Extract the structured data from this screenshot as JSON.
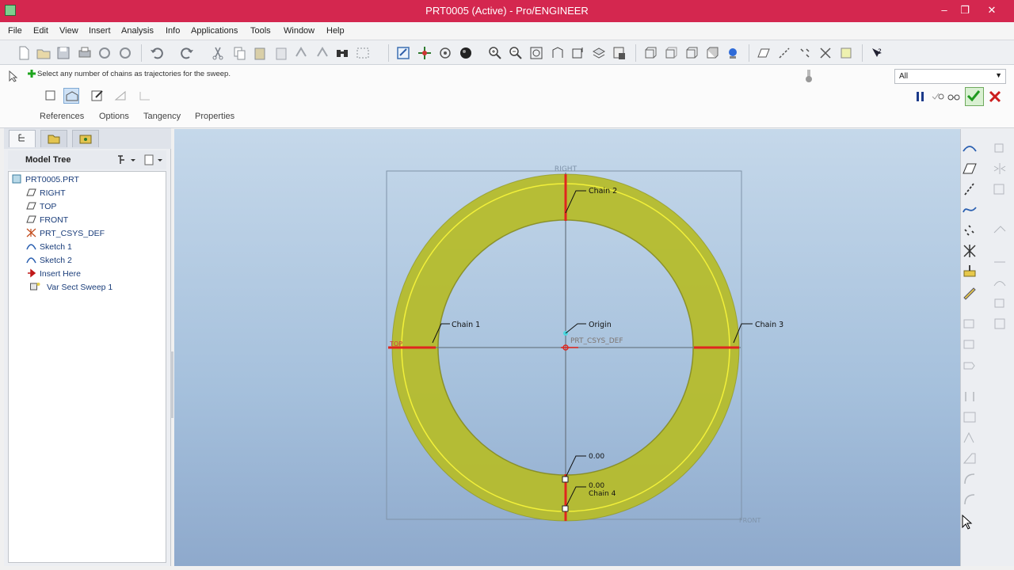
{
  "window": {
    "title": "PRT0005 (Active) - Pro/ENGINEER",
    "minimize": "–",
    "restore": "❐",
    "close": "✕"
  },
  "menu": [
    "File",
    "Edit",
    "View",
    "Insert",
    "Analysis",
    "Info",
    "Applications",
    "Tools",
    "Window",
    "Help"
  ],
  "dashboard": {
    "prompt": "Select any number of chains as trajectories for the sweep.",
    "filter_value": "All",
    "tabs": [
      "References",
      "Options",
      "Tangency",
      "Properties"
    ]
  },
  "navigator": {
    "title": "Model Tree",
    "items": [
      {
        "label": "PRT0005.PRT",
        "icon": "part-icon"
      },
      {
        "label": "RIGHT",
        "icon": "datum-plane-icon"
      },
      {
        "label": "TOP",
        "icon": "datum-plane-icon"
      },
      {
        "label": "FRONT",
        "icon": "datum-plane-icon"
      },
      {
        "label": "PRT_CSYS_DEF",
        "icon": "csys-icon"
      },
      {
        "label": "Sketch 1",
        "icon": "sketch-icon"
      },
      {
        "label": "Sketch 2",
        "icon": "sketch-icon"
      },
      {
        "label": "Insert Here",
        "icon": "insert-arrow-icon"
      },
      {
        "label": "Var Sect Sweep 1",
        "icon": "sweep-feature-icon"
      }
    ]
  },
  "graphics": {
    "plane_right": "RIGHT",
    "plane_top": "TOP",
    "csys": "PRT_CSYS_DEF",
    "front": "FRONT",
    "labels": {
      "chain1": "Chain 1",
      "chain2": "Chain 2",
      "chain3": "Chain 3",
      "chain4": "Chain 4",
      "origin": "Origin",
      "dim1": "0.00",
      "dim2": "0.00"
    },
    "colors": {
      "ring": "#b5bc2c",
      "trajectory": "#f2f03a",
      "datum_red": "#e0261e"
    }
  }
}
